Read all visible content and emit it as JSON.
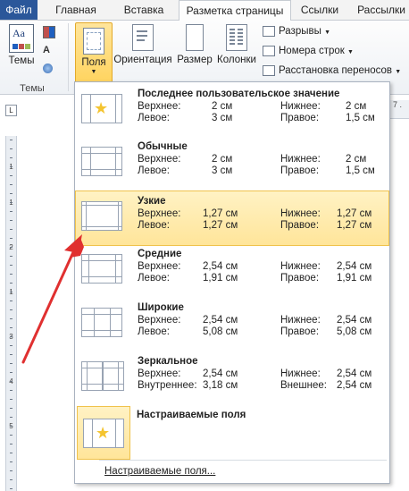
{
  "tabs": {
    "file": "Файл",
    "home": "Главная",
    "insert": "Вставка",
    "layout": "Разметка страницы",
    "references": "Ссылки",
    "mailings": "Рассылки"
  },
  "ribbon": {
    "themes_label": "Темы",
    "themes_group": "Темы",
    "margins_label": "Поля",
    "orientation_label": "Ориентация",
    "size_label": "Размер",
    "columns_label": "Колонки",
    "breaks_label": "Разрывы",
    "line_numbers_label": "Номера строк",
    "hyphenation_label": "Расстановка переносов",
    "theme_icon_text": "Aa",
    "ruler_corner": "L",
    "ruler_top_nums": ". 7 ."
  },
  "margins_menu": {
    "items": [
      {
        "name": "Последнее пользовательское значение",
        "top_label": "Верхнее:",
        "top": "2 см",
        "bottom_label": "Нижнее:",
        "bottom": "2 см",
        "left_label": "Левое:",
        "left": "3 см",
        "right_label": "Правое:",
        "right": "1,5 см"
      },
      {
        "name": "Обычные",
        "top_label": "Верхнее:",
        "top": "2 см",
        "bottom_label": "Нижнее:",
        "bottom": "2 см",
        "left_label": "Левое:",
        "left": "3 см",
        "right_label": "Правое:",
        "right": "1,5 см"
      },
      {
        "name": "Узкие",
        "top_label": "Верхнее:",
        "top": "1,27 см",
        "bottom_label": "Нижнее:",
        "bottom": "1,27 см",
        "left_label": "Левое:",
        "left": "1,27 см",
        "right_label": "Правое:",
        "right": "1,27 см"
      },
      {
        "name": "Средние",
        "top_label": "Верхнее:",
        "top": "2,54 см",
        "bottom_label": "Нижнее:",
        "bottom": "2,54 см",
        "left_label": "Левое:",
        "left": "1,91 см",
        "right_label": "Правое:",
        "right": "1,91 см"
      },
      {
        "name": "Широкие",
        "top_label": "Верхнее:",
        "top": "2,54 см",
        "bottom_label": "Нижнее:",
        "bottom": "2,54 см",
        "left_label": "Левое:",
        "left": "5,08 см",
        "right_label": "Правое:",
        "right": "5,08 см"
      },
      {
        "name": "Зеркальное",
        "top_label": "Верхнее:",
        "top": "2,54 см",
        "bottom_label": "Нижнее:",
        "bottom": "2,54 см",
        "left_label": "Внутреннее:",
        "left": "3,18 см",
        "right_label": "Внешнее:",
        "right": "2,54 см"
      }
    ],
    "custom_name": "Настраиваемые поля",
    "custom_link": "Настраиваемые поля...",
    "highlighted": "Узкие"
  },
  "ruler": {
    "nums": [
      "1",
      "1",
      "2",
      "1",
      "3",
      "4",
      "5"
    ]
  },
  "colors": {
    "file_tab": "#2b579a",
    "highlight": "#ffe59a",
    "arrow": "#e03030",
    "star": "#f4c430"
  }
}
